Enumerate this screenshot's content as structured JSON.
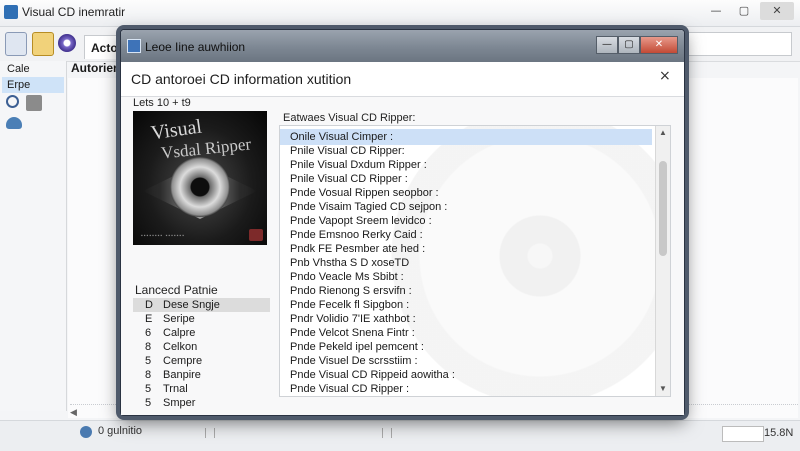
{
  "background_window": {
    "title": "Visual CD inemratir",
    "tab_label": "Actoe",
    "header_text": "Autorienr",
    "sidebar": {
      "items": [
        "Cale",
        "Erpe"
      ]
    },
    "status": {
      "text": "0 gulnitio",
      "size": "15.8N"
    }
  },
  "dialog": {
    "window_title": "Leoe Iine auwhiion",
    "header_title": "CD antoroei CD information xutition",
    "close_glyph": "×",
    "list_caption": "Lets 10 + t9",
    "album_art": {
      "title_line1": "Visual",
      "title_line2": "Vsdal Ripper"
    },
    "tracks_heading": "Lancecd Patnie",
    "tracks": [
      {
        "num": "D",
        "name": "Dese Sngje"
      },
      {
        "num": "E",
        "name": "Seripe"
      },
      {
        "num": "6",
        "name": "Calpre"
      },
      {
        "num": "8",
        "name": "Celkon"
      },
      {
        "num": "5",
        "name": "Cempre"
      },
      {
        "num": "8",
        "name": "Banpire"
      },
      {
        "num": "5",
        "name": "Trnal"
      },
      {
        "num": "5",
        "name": "Smper"
      }
    ],
    "releases_label": "Eatwaes Visual CD Ripper:",
    "releases": [
      "Onile Visual Cimper :",
      "Pnile Visual CD Ripper:",
      "Pnile Visual Dxdum Ripper :",
      "Pnile Visual CD Ripper :",
      "Pnde Vosual Rippen seopbor :",
      "Pnde Visaim Tagied CD sejpon :",
      "Pnde Vapopt Sreem levidco :",
      "Pnde Emsnoo Rerky Caid :",
      "Pndk FE Pesmber ate hed :",
      "Pnb Vhstha S D xoseTD",
      "Pndo Veacle Ms Sbibt :",
      "Pndo Rienong S ersvifn :",
      "Pnde Fecelk fl Sipgbon :",
      "Pndr Volidio 7'IE xathbot :",
      "Pnde Velcot Snena Fintr :",
      "Pnde Pekeld ipel pemcent :",
      "Pnde Visuel De scrsstiim :",
      "Pnde Visual CD Rippeid aowitha :",
      "Pnde Visual CD Ripper :"
    ],
    "selected_release_index": 0
  },
  "colors": {
    "selection": "#cde0f7",
    "dialog_chrome": "#7d8793",
    "close_button": "#c24a35"
  }
}
